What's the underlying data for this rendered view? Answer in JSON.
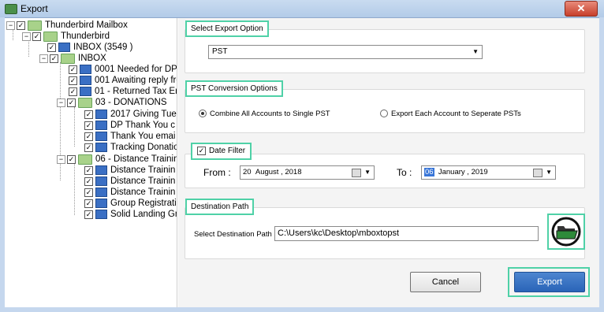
{
  "window": {
    "title": "Export",
    "close_label": "✕"
  },
  "tree": {
    "items": [
      {
        "label": "Thunderbird Mailbox"
      },
      {
        "label": "Thunderbird"
      },
      {
        "label": "INBOX (3549 )"
      },
      {
        "label": "INBOX"
      },
      {
        "label": "0001 Needed for DP"
      },
      {
        "label": "001 Awaiting reply fro"
      },
      {
        "label": "01 - Returned Tax Er"
      },
      {
        "label": "03 - DONATIONS"
      },
      {
        "label": "2017 Giving Tues"
      },
      {
        "label": "DP Thank You c"
      },
      {
        "label": "Thank You emai"
      },
      {
        "label": "Tracking Donatio"
      },
      {
        "label": "06 - Distance Trainin"
      },
      {
        "label": "Distance Trainin"
      },
      {
        "label": "Distance Trainin"
      },
      {
        "label": "Distance Trainin"
      },
      {
        "label": "Group Registrati"
      },
      {
        "label": "Solid Landing Gr"
      }
    ]
  },
  "export_option": {
    "title": "Select Export Option",
    "selected": "PST"
  },
  "conversion": {
    "title": "PST Conversion Options",
    "option1": "Combine All Accounts to Single PST",
    "option2": "Export Each Account to Seperate PSTs"
  },
  "date_filter": {
    "title": "Date Filter",
    "from_label": "From :",
    "from_day": "20",
    "from_rest": "August  , 2018",
    "to_label": "To :",
    "to_day": "06",
    "to_rest": "January  , 2019"
  },
  "destination": {
    "title": "Destination Path",
    "label": "Select Destination Path",
    "path": "C:\\Users\\kc\\Desktop\\mboxtopst"
  },
  "buttons": {
    "cancel": "Cancel",
    "export": "Export"
  },
  "colors": {
    "highlight": "#4fd1a7",
    "export_button": "#2a64b8"
  }
}
